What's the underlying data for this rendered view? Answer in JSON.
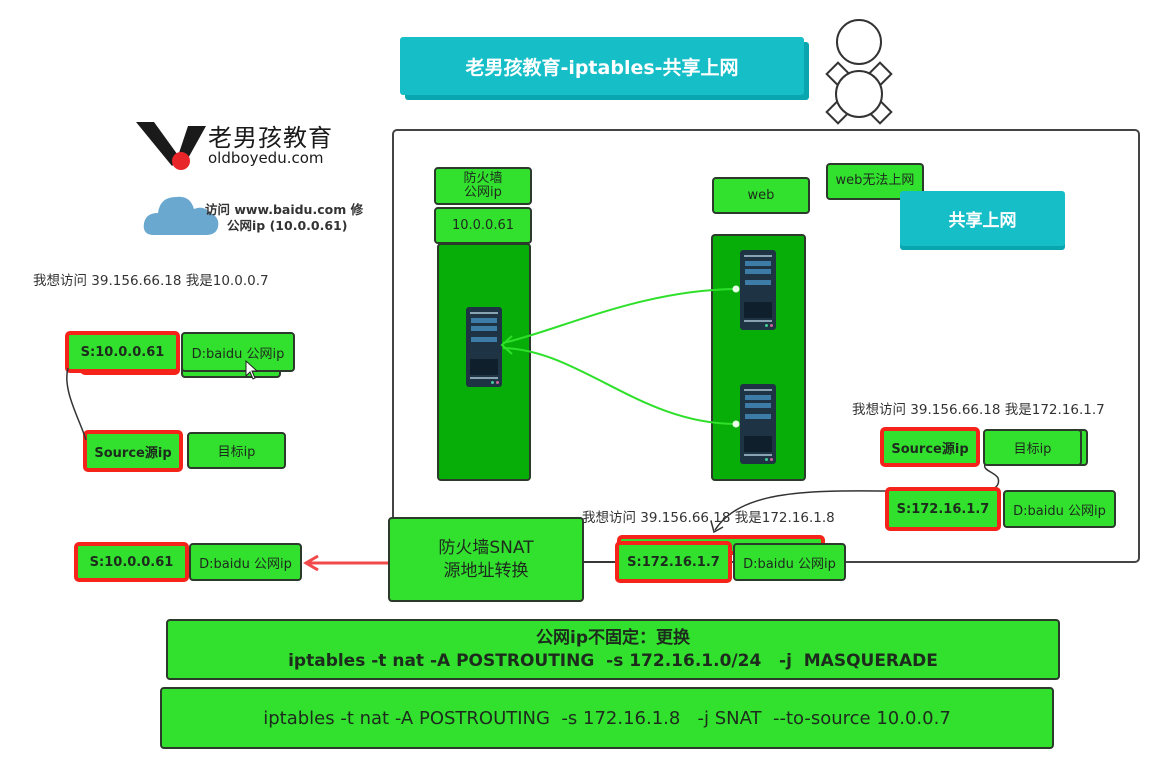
{
  "header": {
    "title": "老男孩教育-iptables-共享上网"
  },
  "logo": {
    "brand_cn": "老男孩教育",
    "brand_url": "oldboyedu.com"
  },
  "cloud_note": {
    "line1": "访问 www.baidu.com 修",
    "line2": "公网ip (10.0.0.61)"
  },
  "left_panel": {
    "note": "我想访问 39.156.66.18 我是10.0.0.7",
    "packet": {
      "src": "S:10.0.0.61",
      "dst": "D:baidu 公网ip"
    },
    "legend": {
      "src": "Source源ip",
      "dst": "目标ip"
    }
  },
  "network_frame": {
    "firewall_label": "防火墙\n公网ip",
    "firewall_ip": "10.0.0.61",
    "web_label": "web",
    "web_status": "web无法上网",
    "badge": "共享上网"
  },
  "right_panel": {
    "note": "我想访问 39.156.66.18 我是172.16.1.7",
    "legend": {
      "src": "Source源ip",
      "dst": "目标ip"
    },
    "packet": {
      "src": "S:172.16.1.7",
      "dst": "D:baidu 公网ip"
    }
  },
  "snat": {
    "label_line1": "防火墙SNAT",
    "label_line2": "源地址转换",
    "in_note": "我想访问 39.156.66.18 我是172.16.1.8",
    "in_packet": {
      "src": "S:172.16.1.7",
      "dst": "D:baidu 公网ip"
    },
    "out_packet": {
      "src": "S:10.0.0.61",
      "dst": "D:baidu 公网ip"
    }
  },
  "commands": {
    "masquerade_title": "公网ip不固定：更换",
    "masquerade_cmd": "iptables -t nat -A POSTROUTING  -s 172.16.1.0/24   -j  MASQUERADE",
    "snat_cmd": "iptables -t nat -A POSTROUTING  -s 172.16.1.8   -j SNAT  --to-source 10.0.0.7"
  },
  "colors": {
    "green": "#32e02e",
    "dark_green": "#07ae07",
    "red_border": "#f5231a",
    "teal": "#16bec7",
    "link_green": "#2fe02b",
    "arrow_red": "#f2494a"
  }
}
